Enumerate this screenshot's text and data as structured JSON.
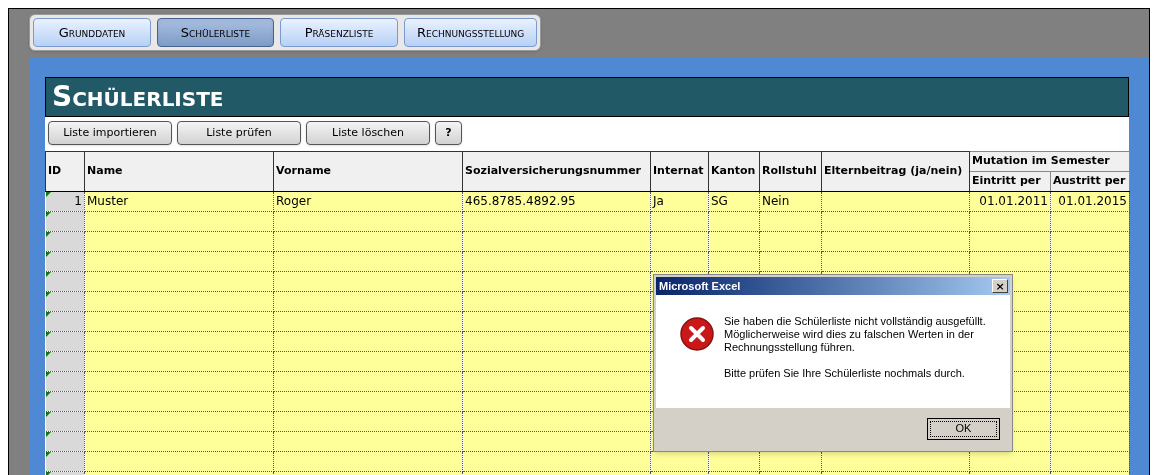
{
  "tabs": [
    {
      "label": "Grunddaten",
      "selected": false
    },
    {
      "label": "Schülerliste",
      "selected": true
    },
    {
      "label": "Präsenzliste",
      "selected": false
    },
    {
      "label": "Rechnungsstellung",
      "selected": false
    }
  ],
  "sheet": {
    "title": "Schülerliste",
    "buttons": [
      "Liste importieren",
      "Liste prüfen",
      "Liste löschen",
      "?"
    ],
    "table": {
      "columns": [
        "ID",
        "Name",
        "Vorname",
        "Sozialversicherungsnummer",
        "Internat",
        "Kanton",
        "Rollstuhl",
        "Elternbeitrag (ja/nein)"
      ],
      "group_header": "Mutation im Semester",
      "group_columns": [
        "Eintritt per",
        "Austritt per"
      ],
      "rows": [
        {
          "cells": [
            "1",
            "Muster",
            "Roger",
            "465.8785.4892.95",
            "Ja",
            "SG",
            "Nein",
            "",
            "01.01.2011",
            "01.01.2015"
          ]
        }
      ]
    }
  },
  "dialog": {
    "title": "Microsoft Excel",
    "message": "Sie haben die Schülerliste nicht vollständig ausgefüllt. Möglicherweise wird dies zu falschen Werten in der Rechnungsstellung führen.",
    "hint": "Bitte prüfen Sie Ihre Schülerliste nochmals durch.",
    "close": "×",
    "button": "OK"
  }
}
